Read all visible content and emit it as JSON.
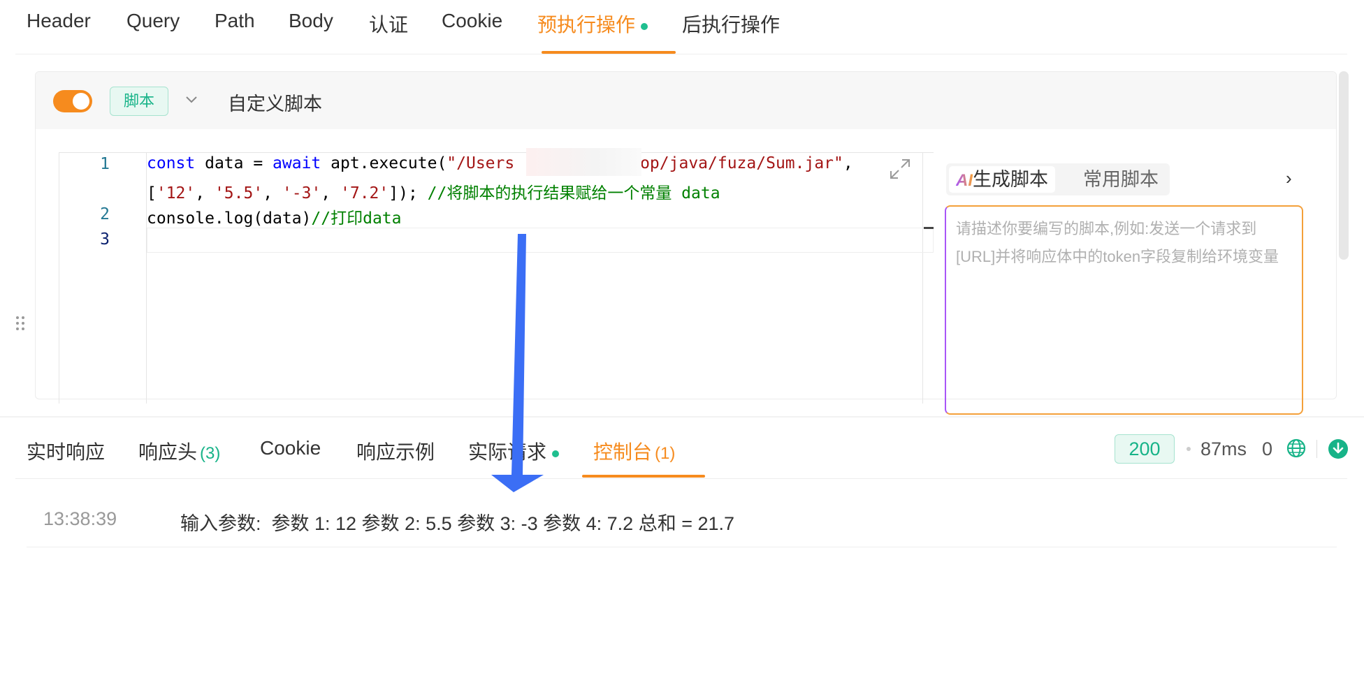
{
  "top_tabs": [
    {
      "label": "Header"
    },
    {
      "label": "Query"
    },
    {
      "label": "Path"
    },
    {
      "label": "Body"
    },
    {
      "label": "认证"
    },
    {
      "label": "Cookie"
    },
    {
      "label": "预执行操作",
      "active": true,
      "has_dot": true
    },
    {
      "label": "后执行操作"
    }
  ],
  "script_panel": {
    "enabled": true,
    "badge": "脚本",
    "title": "自定义脚本"
  },
  "editor": {
    "line_numbers": [
      "1",
      "2",
      "3"
    ],
    "line1_a": {
      "kw1": "const",
      "t1": " data = ",
      "kw2": "await",
      "t2": " apt.execute(",
      "s1": "\"/Users",
      "s2": "top/java/fuza/Sum.jar\"",
      "t3": ","
    },
    "line1_b": {
      "t0": "[",
      "a1": "'12'",
      "c1": ", ",
      "a2": "'5.5'",
      "c2": ", ",
      "a3": "'-3'",
      "c3": ", ",
      "a4": "'7.2'",
      "t1": "]); ",
      "cm": "//将脚本的执行结果赋给一个常量 data"
    },
    "line2": {
      "code": "console.log(data)",
      "cm": "//打印data"
    }
  },
  "ai_panel": {
    "tab_generate": "生成脚本",
    "tab_common": "常用脚本",
    "ai_logo": "AI",
    "placeholder": "请描述你要编写的脚本,例如:发送一个请求到[URL]并将响应体中的token字段复制给环境变量"
  },
  "bottom_tabs": [
    {
      "label": "实时响应"
    },
    {
      "label": "响应头",
      "count": "(3)"
    },
    {
      "label": "Cookie"
    },
    {
      "label": "响应示例"
    },
    {
      "label": "实际请求",
      "has_dot": true
    },
    {
      "label": "控制台",
      "count": "(1)",
      "active": true
    }
  ],
  "status": {
    "code": "200",
    "time": "87ms",
    "size": "0"
  },
  "console": [
    {
      "time": "13:38:39",
      "message": "输入参数:  参数 1: 12 参数 2: 5.5 参数 3: -3 参数 4: 7.2 总和 = 21.7"
    }
  ],
  "colors": {
    "accent": "#f68b1e",
    "success": "#17b388",
    "arrow": "#3b6ef5"
  }
}
